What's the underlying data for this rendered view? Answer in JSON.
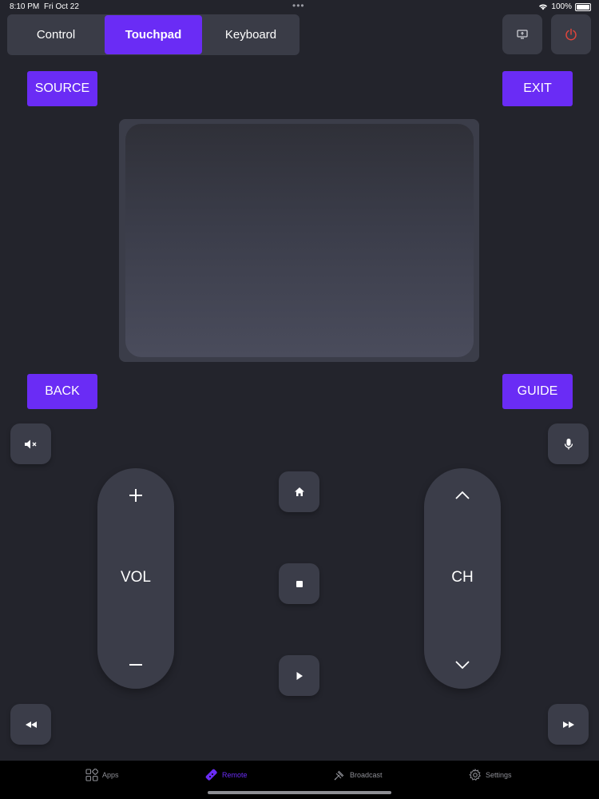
{
  "status_bar": {
    "time": "8:10 PM",
    "date": "Fri Oct 22",
    "battery": "100%"
  },
  "mode_tabs": [
    {
      "label": "Control",
      "active": false
    },
    {
      "label": "Touchpad",
      "active": true
    },
    {
      "label": "Keyboard",
      "active": false
    }
  ],
  "buttons": {
    "source": "SOURCE",
    "exit": "EXIT",
    "back": "BACK",
    "guide": "GUIDE"
  },
  "volume": {
    "label": "VOL",
    "up": "+",
    "down": "–"
  },
  "channel": {
    "label": "CH"
  },
  "tabbar": [
    {
      "label": "Apps",
      "icon": "apps-icon",
      "active": false
    },
    {
      "label": "Remote",
      "icon": "remote-icon",
      "active": true
    },
    {
      "label": "Broadcast",
      "icon": "broadcast-icon",
      "active": false
    },
    {
      "label": "Settings",
      "icon": "settings-icon",
      "active": false
    }
  ],
  "colors": {
    "accent": "#6a2cf5",
    "background": "#23242c",
    "surface": "#3b3d49",
    "power_red": "#e0453b"
  }
}
